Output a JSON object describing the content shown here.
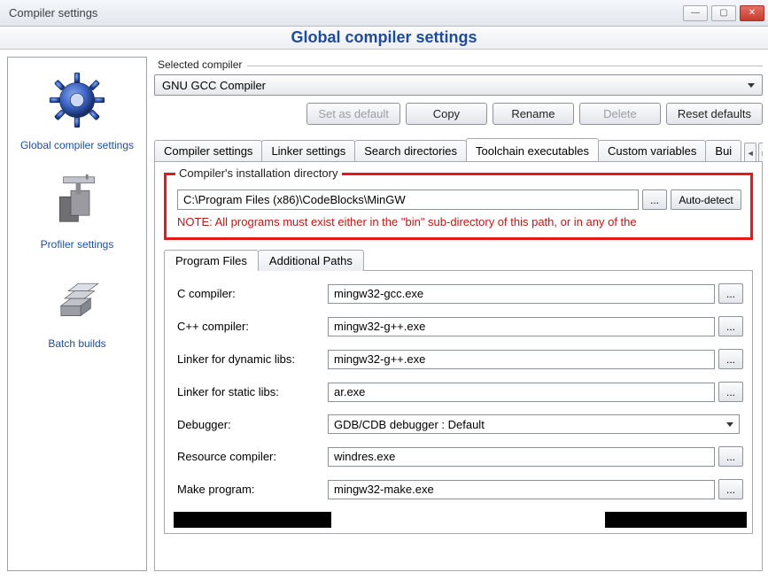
{
  "window": {
    "title": "Compiler settings"
  },
  "header": {
    "title": "Global compiler settings"
  },
  "sidebar": {
    "items": [
      {
        "label": "Global compiler settings"
      },
      {
        "label": "Profiler settings"
      },
      {
        "label": "Batch builds"
      }
    ]
  },
  "selected_compiler": {
    "label": "Selected compiler",
    "value": "GNU GCC Compiler",
    "buttons": {
      "set_default": "Set as default",
      "copy": "Copy",
      "rename": "Rename",
      "delete": "Delete",
      "reset": "Reset defaults"
    }
  },
  "tabs": {
    "items": [
      "Compiler settings",
      "Linker settings",
      "Search directories",
      "Toolchain executables",
      "Custom variables",
      "Bui"
    ]
  },
  "install_dir": {
    "legend": "Compiler's installation directory",
    "path": "C:\\Program Files (x86)\\CodeBlocks\\MinGW",
    "browse": "...",
    "auto": "Auto-detect",
    "note": "NOTE: All programs must exist either in the \"bin\" sub-directory of this path, or in any of the"
  },
  "subtabs": {
    "items": [
      "Program Files",
      "Additional Paths"
    ]
  },
  "programs": {
    "c_compiler": {
      "label": "C compiler:",
      "value": "mingw32-gcc.exe"
    },
    "cpp_compiler": {
      "label": "C++ compiler:",
      "value": "mingw32-g++.exe"
    },
    "linker_dyn": {
      "label": "Linker for dynamic libs:",
      "value": "mingw32-g++.exe"
    },
    "linker_stat": {
      "label": "Linker for static libs:",
      "value": "ar.exe"
    },
    "debugger": {
      "label": "Debugger:",
      "value": "GDB/CDB debugger : Default"
    },
    "res_compiler": {
      "label": "Resource compiler:",
      "value": "windres.exe"
    },
    "make": {
      "label": "Make program:",
      "value": "mingw32-make.exe"
    }
  },
  "browse_label": "..."
}
